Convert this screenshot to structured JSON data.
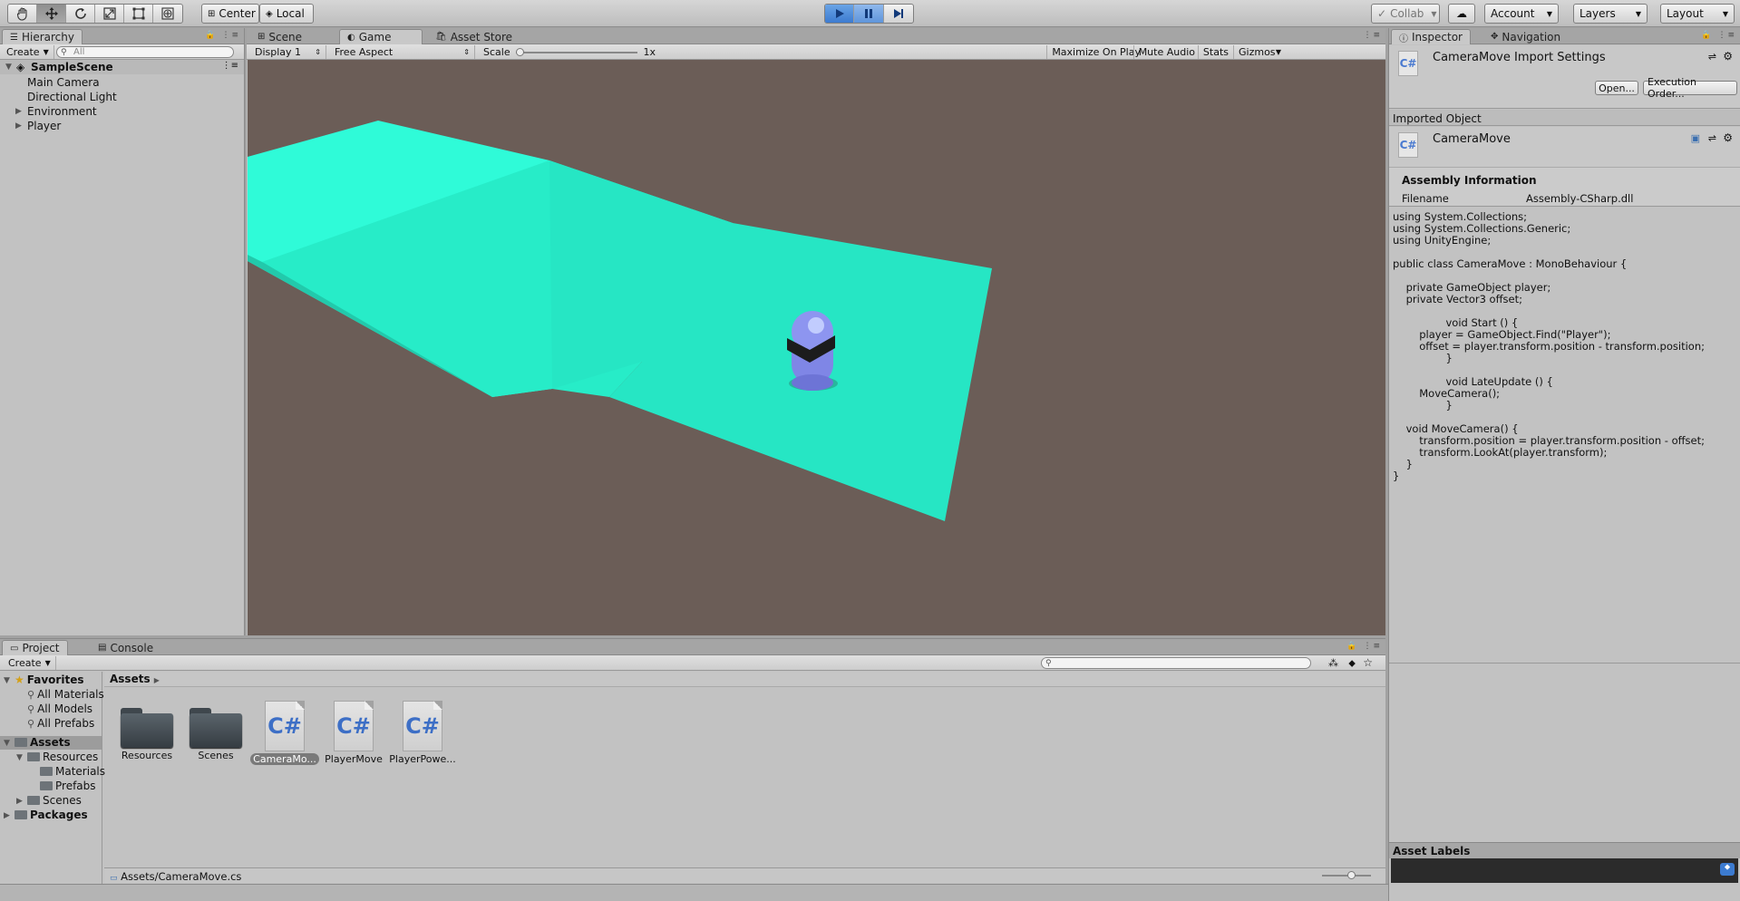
{
  "toolbar": {
    "tools": [
      "hand-tool-icon",
      "move-tool-icon",
      "rotate-tool-icon",
      "scale-tool-icon",
      "rect-tool-icon",
      "transform-tool-icon"
    ],
    "pivot_label": "Center",
    "space_label": "Local",
    "collab_label": "Collab",
    "account_label": "Account",
    "layers_label": "Layers",
    "layout_label": "Layout"
  },
  "hierarchy": {
    "tab": "Hierarchy",
    "create_label": "Create",
    "search_placeholder": "All",
    "scene_name": "SampleScene",
    "items": [
      "Main Camera",
      "Directional Light",
      "Environment",
      "Player"
    ]
  },
  "center_tabs": {
    "scene": "Scene",
    "game": "Game",
    "asset_store": "Asset Store"
  },
  "game_bar": {
    "display": "Display 1",
    "aspect": "Free Aspect",
    "scale_label": "Scale",
    "scale_value": "1x",
    "maximize": "Maximize On Play",
    "mute": "Mute Audio",
    "stats": "Stats",
    "gizmos": "Gizmos"
  },
  "inspector": {
    "tab": "Inspector",
    "nav_tab": "Navigation",
    "title": "CameraMove Import Settings",
    "open_btn": "Open...",
    "exec_btn": "Execution Order...",
    "imported_object": "Imported Object",
    "object_name": "CameraMove",
    "cs_glyph": "C#",
    "assembly_heading": "Assembly Information",
    "filename_label": "Filename",
    "filename_value": "Assembly-CSharp.dll",
    "code": "using System.Collections;\nusing System.Collections.Generic;\nusing UnityEngine;\n\npublic class CameraMove : MonoBehaviour {\n\n    private GameObject player;\n    private Vector3 offset;\n\n\t\tvoid Start () {\n        player = GameObject.Find(\"Player\");\n        offset = player.transform.position - transform.position;\n\t\t}\n\n\t\tvoid LateUpdate () {\n        MoveCamera();\n\t\t}\n\n    void MoveCamera() {\n        transform.position = player.transform.position - offset;\n        transform.LookAt(player.transform);\n    }\n}",
    "asset_labels": "Asset Labels"
  },
  "project": {
    "tab": "Project",
    "console_tab": "Console",
    "create_label": "Create",
    "favorites": "Favorites",
    "fav_items": [
      "All Materials",
      "All Models",
      "All Prefabs"
    ],
    "assets_root": "Assets",
    "tree": [
      "Resources",
      "Materials",
      "Prefabs",
      "Scenes"
    ],
    "packages": "Packages",
    "breadcrumb": "Assets",
    "grid": [
      {
        "name": "Resources",
        "kind": "folder"
      },
      {
        "name": "Scenes",
        "kind": "folder"
      },
      {
        "name": "CameraMo...",
        "kind": "script",
        "selected": true
      },
      {
        "name": "PlayerMove",
        "kind": "script"
      },
      {
        "name": "PlayerPowe...",
        "kind": "script"
      }
    ],
    "footer_path": "Assets/CameraMove.cs"
  },
  "colors": {
    "game_bg": "#6b5d57",
    "floor": "#2ef0c8",
    "player": "#7f86e6",
    "play_active": "#3c7bd0"
  }
}
